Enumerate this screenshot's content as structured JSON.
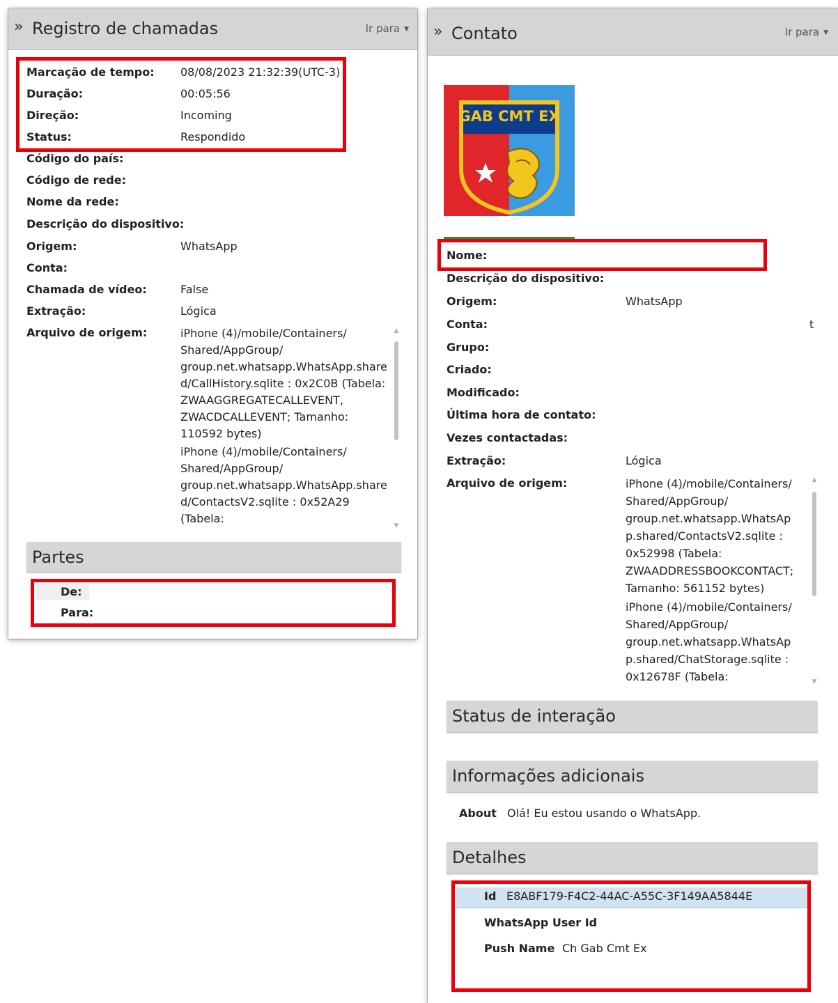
{
  "left": {
    "title": "Registro de chamadas",
    "goto": "Ir para",
    "fields": [
      {
        "label": "Marcação de tempo:",
        "value": "08/08/2023 21:32:39(UTC-3)"
      },
      {
        "label": "Duração:",
        "value": "00:05:56"
      },
      {
        "label": "Direção:",
        "value": "Incoming"
      },
      {
        "label": "Status:",
        "value": "Respondido"
      },
      {
        "label": "Código do país:",
        "value": ""
      },
      {
        "label": "Código de rede:",
        "value": ""
      },
      {
        "label": "Nome da rede:",
        "value": ""
      },
      {
        "label": "Descrição do dispositivo:",
        "value": ""
      },
      {
        "label": "Origem:",
        "value": "WhatsApp"
      },
      {
        "label": "Conta:",
        "value": ""
      },
      {
        "label": "Chamada de vídeo:",
        "value": "False"
      },
      {
        "label": "Extração:",
        "value": "Lógica"
      },
      {
        "label": "Arquivo de origem:",
        "value": ""
      }
    ],
    "source_lines": [
      "iPhone (4)/mobile/Containers/",
      "Shared/AppGroup/",
      "group.net.whatsapp.WhatsApp.share",
      "d/CallHistory.sqlite : 0x2C0B (Tabela:",
      "ZWAAGGREGATECALLEVENT,",
      "ZWACDCALLEVENT; Tamanho:",
      "110592 bytes)",
      "iPhone (4)/mobile/Containers/",
      "Shared/AppGroup/",
      "group.net.whatsapp.WhatsApp.share",
      "d/ContactsV2.sqlite : 0x52A29",
      "(Tabela:"
    ],
    "parties": {
      "title": "Partes",
      "from_label": "De:",
      "to_label": "Para:"
    }
  },
  "right": {
    "title": "Contato",
    "goto": "Ir para",
    "logo_text": "GAB CMT EX",
    "fields": [
      {
        "label": "Nome:",
        "value": ""
      },
      {
        "label": "Descrição do dispositivo:",
        "value": ""
      },
      {
        "label": "Origem:",
        "value": "WhatsApp"
      },
      {
        "label": "Conta:",
        "value": "t"
      },
      {
        "label": "Grupo:",
        "value": ""
      },
      {
        "label": "Criado:",
        "value": ""
      },
      {
        "label": "Modificado:",
        "value": ""
      },
      {
        "label": "Última hora de contato:",
        "value": ""
      },
      {
        "label": "Vezes contactadas:",
        "value": ""
      },
      {
        "label": "Extração:",
        "value": "Lógica"
      },
      {
        "label": "Arquivo de origem:",
        "value": ""
      }
    ],
    "source_lines": [
      "iPhone (4)/mobile/Containers/",
      "Shared/AppGroup/",
      "group.net.whatsapp.WhatsAp",
      "p.shared/ContactsV2.sqlite :",
      "0x52998 (Tabela:",
      "ZWAADDRESSBOOKCONTACT;",
      "Tamanho: 561152 bytes)",
      "iPhone (4)/mobile/Containers/",
      "Shared/AppGroup/",
      "group.net.whatsapp.WhatsAp",
      "p.shared/ChatStorage.sqlite :",
      "0x12678F (Tabela:"
    ],
    "interaction_title": "Status de interação",
    "additional": {
      "title": "Informações adicionais",
      "about_label": "About",
      "about_value": "Olá! Eu estou usando o WhatsApp."
    },
    "details": {
      "title": "Detalhes",
      "rows": [
        {
          "label": "Id",
          "value": "E8ABF179-F4C2-44AC-A55C-3F149AA5844E"
        },
        {
          "label": "WhatsApp User Id",
          "value": ""
        },
        {
          "label": "Push Name",
          "value": "Ch Gab Cmt Ex"
        }
      ]
    }
  },
  "colors": {
    "highlight_red": "#e8000b",
    "header_gray": "#d5d5d5",
    "selected_row": "#cfe3f1"
  }
}
